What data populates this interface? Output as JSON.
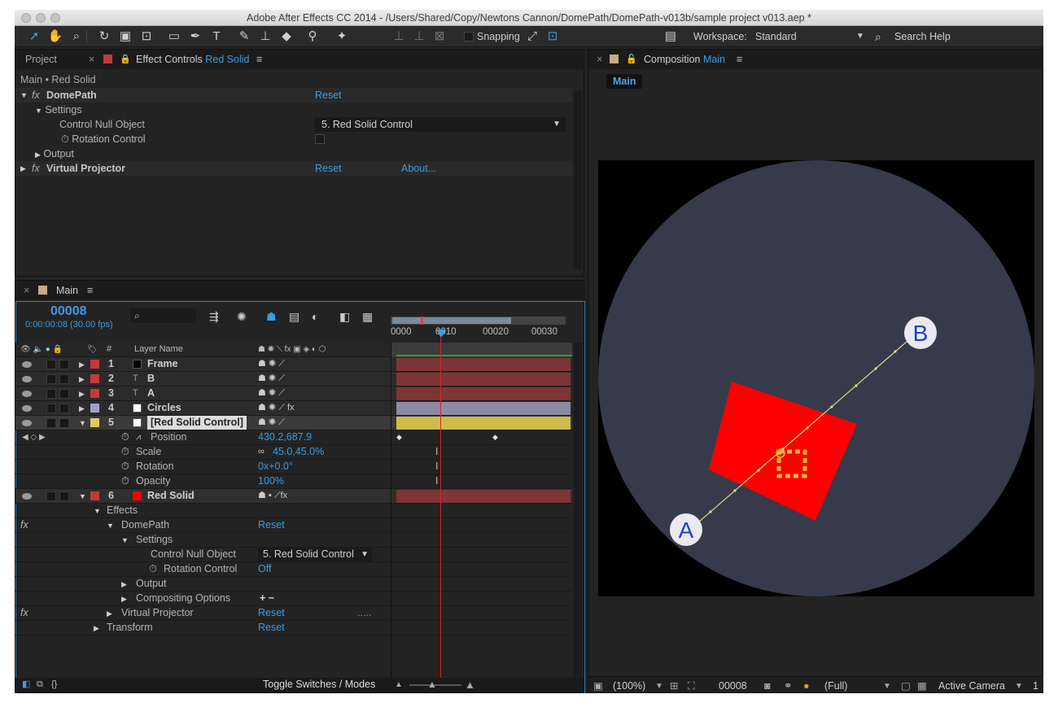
{
  "window": {
    "title": "Adobe After Effects CC 2014 - /Users/Shared/Copy/Newtons Cannon/DomePath/DomePath-v013b/sample project v013.aep *"
  },
  "toolbar": {
    "snapping_label": "Snapping",
    "workspace_label": "Workspace:",
    "workspace_value": "Standard",
    "search_label": "Search Help",
    "tools": [
      "selection-tool",
      "hand-tool",
      "zoom-tool",
      "rotation-tool",
      "camera-tool",
      "pan-behind-tool",
      "rectangle-tool",
      "pen-tool",
      "type-tool",
      "brush-tool",
      "clone-stamp-tool",
      "eraser-tool",
      "roto-brush-tool",
      "puppet-pin-tool"
    ]
  },
  "project_panel": {
    "tab_project": "Project",
    "tab_effect_controls_label": "Effect Controls",
    "tab_effect_controls_layer": "Red Solid",
    "breadcrumb": "Main • Red Solid",
    "effects": [
      {
        "name": "DomePath",
        "reset": "Reset"
      },
      {
        "name": "Virtual Projector",
        "reset": "Reset",
        "about": "About..."
      }
    ],
    "settings_label": "Settings",
    "control_null_label": "Control Null Object",
    "control_null_value": "5. Red Solid Control",
    "rotation_control_label": "Rotation Control",
    "output_label": "Output"
  },
  "composition_panel": {
    "tab_label": "Composition",
    "tab_comp": "Main",
    "comp_button": "Main",
    "point_a": "A",
    "point_b": "B",
    "footer": {
      "zoom": "(100%)",
      "timecode": "00008",
      "resolution": "(Full)",
      "camera": "Active Camera",
      "views": "1"
    }
  },
  "timeline": {
    "tab_label": "Main",
    "timecode": "00008",
    "timecode_sub": "0:00:00:08 (30.00 fps)",
    "ruler": [
      "0000",
      "0010",
      "00020",
      "00030"
    ],
    "column_header_number": "#",
    "column_header_layer_name": "Layer Name",
    "layers": [
      {
        "num": "1",
        "name": "Frame",
        "label_color": "#c23a3a",
        "swatch": "#000000",
        "kind": "solid"
      },
      {
        "num": "2",
        "name": "B",
        "label_color": "#c23a3a",
        "swatch": "",
        "kind": "text"
      },
      {
        "num": "3",
        "name": "A",
        "label_color": "#c23a3a",
        "swatch": "",
        "kind": "text"
      },
      {
        "num": "4",
        "name": "Circles",
        "label_color": "#9fa0d0",
        "swatch": "#ffffff",
        "kind": "solid"
      },
      {
        "num": "5",
        "name": "[Red Solid Control]",
        "label_color": "#e0cb5a",
        "swatch": "#ffffff",
        "kind": "solid"
      }
    ],
    "layer5_props": [
      {
        "name": "Position",
        "value": "430.2,687.9"
      },
      {
        "name": "Scale",
        "value": "45.0,45.0%"
      },
      {
        "name": "Rotation",
        "value": "0x+0.0°"
      },
      {
        "name": "Opacity",
        "value": "100%"
      }
    ],
    "layer6": {
      "num": "6",
      "name": "Red Solid",
      "label_color": "#c23a3a",
      "swatch": "#ff0000"
    },
    "layer6_tree": {
      "effects": "Effects",
      "domepath": "DomePath",
      "reset": "Reset",
      "settings": "Settings",
      "control_null_label": "Control Null Object",
      "control_null_value": "5. Red Solid Control",
      "rotation_control_label": "Rotation Control",
      "rotation_control_value": "Off",
      "output": "Output",
      "compositing_options": "Compositing Options",
      "compositing_plus_minus": "+ −",
      "virtual_projector": "Virtual Projector",
      "vp_reset": "Reset",
      "vp_dots": ".....",
      "transform": "Transform",
      "transform_reset": "Reset"
    },
    "footer_toggle": "Toggle Switches / Modes",
    "bar_colors": [
      "#7d3537",
      "#7d3537",
      "#7d3537",
      "#8b8ba6",
      "#cdbb4c",
      "#7d3537"
    ]
  }
}
